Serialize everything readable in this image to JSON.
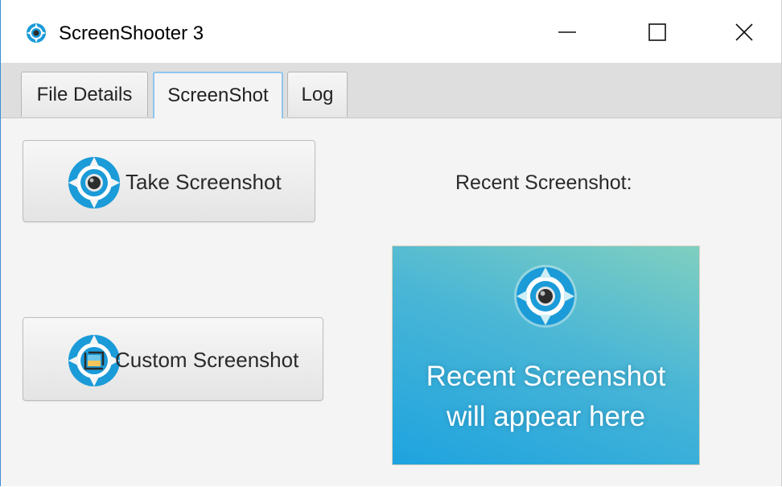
{
  "window": {
    "title": "ScreenShooter 3",
    "controls": {
      "minimize": "minimize-icon",
      "maximize": "maximize-icon",
      "close": "close-icon"
    }
  },
  "tabs": [
    {
      "label": "File Details",
      "selected": false
    },
    {
      "label": "ScreenShot",
      "selected": true
    },
    {
      "label": "Log",
      "selected": false
    }
  ],
  "actions": {
    "take": {
      "label": "Take Screenshot",
      "icon": "camera-shutter-icon"
    },
    "custom": {
      "label": "Custom Screenshot",
      "icon": "crop-shutter-icon"
    }
  },
  "recent": {
    "label": "Recent Screenshot:",
    "placeholder_line1": "Recent Screenshot",
    "placeholder_line2": "will appear here",
    "placeholder_icon": "camera-shutter-icon"
  },
  "colors": {
    "accent": "#1b9bd8",
    "tab_selected_border": "#8fc6ec",
    "preview_gradient_start": "#7fcfc0",
    "preview_gradient_end": "#1ea3df"
  }
}
